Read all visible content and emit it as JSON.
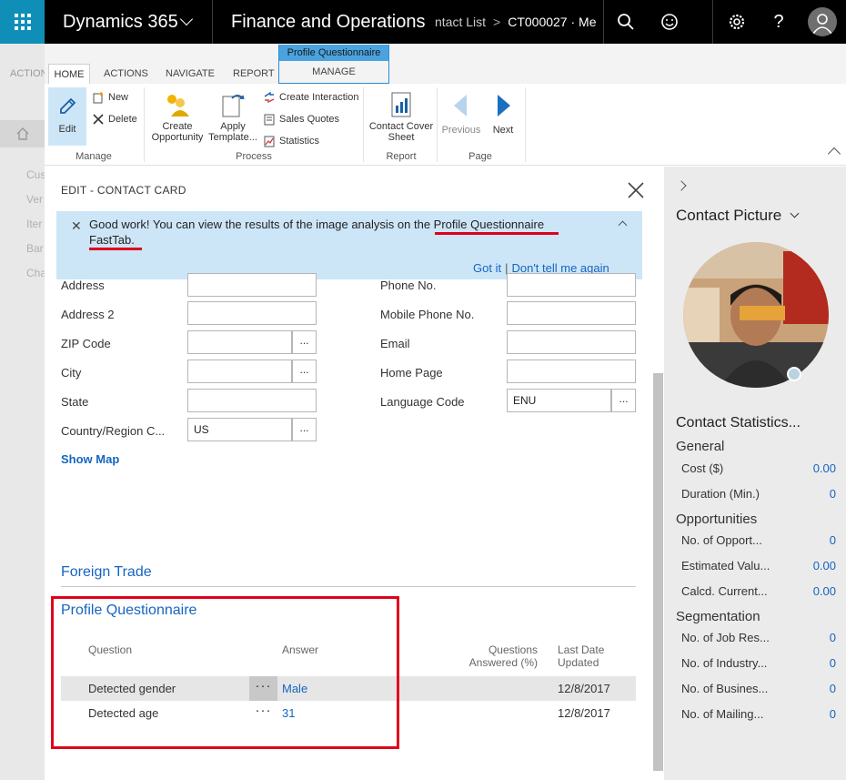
{
  "topbar": {
    "app_name": "Dynamics 365",
    "module_name": "Finance and Operations",
    "breadcrumb_prev": "ntact List",
    "breadcrumb_current": "CT000027 · Me"
  },
  "left_bg": {
    "action_label": "ACTION",
    "nav_items": [
      "Cus",
      "Ver",
      "Iter",
      "Bar",
      "Cha"
    ]
  },
  "ribbon": {
    "tabs": [
      "HOME",
      "ACTIONS",
      "NAVIGATE",
      "REPORT"
    ],
    "context_group_title": "Profile Questionnaire",
    "context_tab": "MANAGE",
    "manage": {
      "edit": "Edit",
      "new": "New",
      "delete": "Delete",
      "label": "Manage"
    },
    "process": {
      "create_opportunity_1": "Create",
      "create_opportunity_2": "Opportunity",
      "apply_template_1": "Apply",
      "apply_template_2": "Template...",
      "create_interaction": "Create Interaction",
      "sales_quotes": "Sales Quotes",
      "statistics": "Statistics",
      "label": "Process"
    },
    "report": {
      "contact_cover_1": "Contact Cover",
      "contact_cover_2": "Sheet",
      "label": "Report"
    },
    "page": {
      "previous": "Previous",
      "next": "Next",
      "label": "Page"
    }
  },
  "card": {
    "title": "EDIT - CONTACT CARD",
    "banner": {
      "text_before": "Good work! You can view the results of the image analysis on the ",
      "link_text": "Profile Questionnaire FastTab",
      "text_after": ".",
      "got_it": "Got it",
      "separator": "|",
      "dont_tell": "Don't tell me again"
    },
    "fields_left": {
      "address": {
        "label": "Address",
        "value": ""
      },
      "address2": {
        "label": "Address 2",
        "value": ""
      },
      "zip": {
        "label": "ZIP Code",
        "value": ""
      },
      "city": {
        "label": "City",
        "value": ""
      },
      "state": {
        "label": "State",
        "value": ""
      },
      "country": {
        "label": "Country/Region C...",
        "value": "US"
      }
    },
    "fields_right": {
      "phone": {
        "label": "Phone No.",
        "value": ""
      },
      "mobile": {
        "label": "Mobile Phone No.",
        "value": ""
      },
      "email": {
        "label": "Email",
        "value": ""
      },
      "homepage": {
        "label": "Home Page",
        "value": ""
      },
      "language": {
        "label": "Language Code",
        "value": "ENU"
      }
    },
    "lookup_glyph": "...",
    "show_map": "Show Map",
    "foreign_trade": "Foreign Trade",
    "profile_questionnaire": {
      "title": "Profile Questionnaire",
      "columns": {
        "question": "Question",
        "answer": "Answer",
        "answered_1": "Questions",
        "answered_2": "Answered (%)",
        "last_date_1": "Last Date",
        "last_date_2": "Updated"
      },
      "rows": [
        {
          "question": "Detected gender",
          "answer": "Male",
          "date": "12/8/2017"
        },
        {
          "question": "Detected age",
          "answer": "31",
          "date": "12/8/2017"
        }
      ],
      "more_glyph": "···"
    }
  },
  "factbox": {
    "contact_picture": "Contact Picture",
    "contact_statistics": "Contact Statistics...",
    "general": "General",
    "general_rows": [
      {
        "label": "Cost ($)",
        "value": "0.00"
      },
      {
        "label": "Duration (Min.)",
        "value": "0"
      }
    ],
    "opportunities": "Opportunities",
    "opportunity_rows": [
      {
        "label": "No. of Opport...",
        "value": "0"
      },
      {
        "label": "Estimated Valu...",
        "value": "0.00"
      },
      {
        "label": "Calcd. Current...",
        "value": "0.00"
      }
    ],
    "segmentation": "Segmentation",
    "segmentation_rows": [
      {
        "label": "No. of Job Res...",
        "value": "0"
      },
      {
        "label": "No. of Industry...",
        "value": "0"
      },
      {
        "label": "No. of Busines...",
        "value": "0"
      },
      {
        "label": "No. of Mailing...",
        "value": "0"
      }
    ]
  },
  "colors": {
    "accent": "#0f8fb8",
    "link": "#1565c0",
    "highlight": "#e0001b",
    "banner_bg": "#cde6f7"
  }
}
